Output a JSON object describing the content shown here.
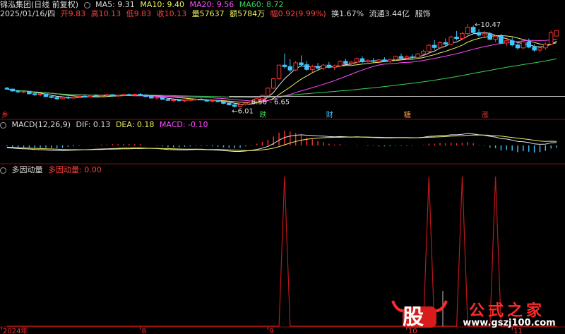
{
  "header": {
    "stock_name": "锦泓集团(日线 前复权)",
    "ma5": "MA5: 9.31",
    "ma10": "MA10: 9.40",
    "ma20": "MA20: 9.56",
    "ma60": "MA60: 8.72",
    "quote": {
      "date": "2025/01/16/四",
      "open": "开9.83",
      "high": "高10.13",
      "low": "低9.83",
      "close": "收10.13",
      "volume": "量57637",
      "amount": "额5784万",
      "change": "幅0.92(9.99%)",
      "turnover": "换1.67%",
      "float_value": "流通3.44亿",
      "sector": "服饰"
    }
  },
  "macd_panel": {
    "title": "MACD(12,26,9)",
    "dif": "DIF: 0.13",
    "dea": "DEA: 0.18",
    "macd": "MACD: -0.10"
  },
  "factor_panel": {
    "title": "多因动量",
    "value_label": "多因动量: 0.00"
  },
  "watermark": {
    "logo_char": "股",
    "brand": "公式之家",
    "url": "www.gszj100.com"
  },
  "colors": {
    "up": "#ff3030",
    "down": "#3ec6ff",
    "ma5": "#e8e8e8",
    "ma10": "#f0f060",
    "ma20": "#ff4cff",
    "ma60": "#39d353",
    "panel_border": "#7a1010",
    "factor": "#c01818"
  },
  "chart_data": [
    {
      "type": "candlestick",
      "title": "锦泓集团(日线 前复权)",
      "ylim": [
        5.8,
        10.7
      ],
      "annotations": [
        {
          "text": "10.47",
          "kind": "high"
        },
        {
          "text": "6.01",
          "kind": "low"
        },
        {
          "text": "6.56 - 6.65",
          "kind": "gap"
        }
      ],
      "event_markers": [
        "跌",
        "财",
        "糖",
        "涨"
      ],
      "ma_lines": [
        "MA5",
        "MA10",
        "MA20",
        "MA60"
      ],
      "x_ticks": [
        "2024年",
        "8",
        "9",
        "10",
        "11"
      ],
      "candles": [
        [
          7.05,
          7.12,
          6.97,
          7.0
        ],
        [
          7.0,
          7.02,
          6.86,
          6.9
        ],
        [
          6.9,
          6.95,
          6.8,
          6.85
        ],
        [
          6.85,
          6.92,
          6.78,
          6.88
        ],
        [
          6.88,
          6.9,
          6.72,
          6.75
        ],
        [
          6.75,
          6.8,
          6.64,
          6.7
        ],
        [
          6.7,
          6.78,
          6.62,
          6.74
        ],
        [
          6.74,
          6.76,
          6.58,
          6.6
        ],
        [
          6.6,
          6.66,
          6.5,
          6.55
        ],
        [
          6.55,
          6.6,
          6.44,
          6.48
        ],
        [
          6.48,
          6.58,
          6.45,
          6.56
        ],
        [
          6.56,
          6.62,
          6.48,
          6.52
        ],
        [
          6.52,
          6.6,
          6.46,
          6.58
        ],
        [
          6.58,
          6.66,
          6.54,
          6.62
        ],
        [
          6.62,
          6.68,
          6.55,
          6.6
        ],
        [
          6.6,
          6.7,
          6.56,
          6.66
        ],
        [
          6.66,
          6.72,
          6.6,
          6.64
        ],
        [
          6.64,
          6.7,
          6.58,
          6.68
        ],
        [
          6.68,
          6.74,
          6.62,
          6.7
        ],
        [
          6.7,
          6.72,
          6.6,
          6.63
        ],
        [
          6.63,
          6.7,
          6.58,
          6.67
        ],
        [
          6.67,
          6.74,
          6.62,
          6.71
        ],
        [
          6.71,
          6.76,
          6.64,
          6.68
        ],
        [
          6.68,
          6.75,
          6.63,
          6.72
        ],
        [
          6.72,
          6.78,
          6.66,
          6.69
        ],
        [
          6.69,
          6.73,
          6.58,
          6.6
        ],
        [
          6.6,
          6.64,
          6.5,
          6.52
        ],
        [
          6.52,
          6.58,
          6.44,
          6.56
        ],
        [
          6.56,
          6.6,
          6.42,
          6.45
        ],
        [
          6.45,
          6.5,
          6.36,
          6.4
        ],
        [
          6.4,
          6.46,
          6.32,
          6.42
        ],
        [
          6.42,
          6.48,
          6.34,
          6.38
        ],
        [
          6.38,
          6.44,
          6.3,
          6.41
        ],
        [
          6.41,
          6.47,
          6.35,
          6.44
        ],
        [
          6.44,
          6.5,
          6.38,
          6.46
        ],
        [
          6.46,
          6.52,
          6.4,
          6.42
        ],
        [
          6.42,
          6.46,
          6.32,
          6.36
        ],
        [
          6.36,
          6.42,
          6.28,
          6.39
        ],
        [
          6.39,
          6.44,
          6.3,
          6.33
        ],
        [
          6.33,
          6.38,
          6.2,
          6.24
        ],
        [
          6.24,
          6.3,
          6.12,
          6.16
        ],
        [
          6.16,
          6.22,
          6.01,
          6.08
        ],
        [
          6.08,
          6.2,
          6.04,
          6.18
        ],
        [
          6.18,
          6.28,
          6.12,
          6.25
        ],
        [
          6.25,
          6.4,
          6.22,
          6.36
        ],
        [
          6.36,
          6.52,
          6.32,
          6.48
        ],
        [
          6.48,
          6.7,
          6.45,
          6.66
        ],
        [
          6.66,
          7.1,
          6.64,
          7.05
        ],
        [
          7.05,
          7.6,
          7.0,
          7.55
        ],
        [
          7.55,
          8.3,
          7.5,
          8.28
        ],
        [
          8.28,
          8.9,
          8.1,
          8.2
        ],
        [
          8.2,
          8.6,
          7.9,
          8.02
        ],
        [
          8.02,
          8.5,
          7.95,
          8.4
        ],
        [
          8.4,
          8.8,
          8.2,
          8.3
        ],
        [
          8.3,
          8.5,
          7.98,
          8.05
        ],
        [
          8.05,
          8.3,
          7.9,
          8.2
        ],
        [
          8.2,
          8.4,
          8.05,
          8.12
        ],
        [
          8.12,
          8.35,
          8.0,
          8.28
        ],
        [
          8.28,
          8.45,
          8.1,
          8.16
        ],
        [
          8.16,
          8.3,
          8.02,
          8.24
        ],
        [
          8.24,
          8.55,
          8.18,
          8.48
        ],
        [
          8.48,
          8.62,
          8.3,
          8.36
        ],
        [
          8.36,
          8.5,
          8.22,
          8.44
        ],
        [
          8.44,
          8.7,
          8.38,
          8.62
        ],
        [
          8.62,
          8.75,
          8.4,
          8.46
        ],
        [
          8.46,
          8.58,
          8.34,
          8.52
        ],
        [
          8.52,
          8.66,
          8.42,
          8.48
        ],
        [
          8.48,
          8.6,
          8.36,
          8.56
        ],
        [
          8.56,
          8.7,
          8.44,
          8.5
        ],
        [
          8.5,
          8.62,
          8.4,
          8.58
        ],
        [
          8.58,
          8.8,
          8.52,
          8.74
        ],
        [
          8.74,
          8.9,
          8.6,
          8.66
        ],
        [
          8.66,
          8.8,
          8.56,
          8.72
        ],
        [
          8.72,
          8.86,
          8.62,
          8.68
        ],
        [
          8.68,
          8.92,
          8.62,
          8.88
        ],
        [
          8.88,
          9.1,
          8.8,
          9.02
        ],
        [
          9.02,
          9.4,
          8.96,
          9.34
        ],
        [
          9.34,
          9.62,
          9.1,
          9.22
        ],
        [
          9.22,
          9.55,
          9.15,
          9.48
        ],
        [
          9.48,
          9.7,
          9.3,
          9.4
        ],
        [
          9.4,
          9.85,
          9.35,
          9.78
        ],
        [
          9.78,
          10.1,
          9.6,
          9.7
        ],
        [
          9.7,
          10.05,
          9.62,
          9.96
        ],
        [
          9.96,
          10.47,
          9.9,
          10.3
        ],
        [
          10.3,
          10.4,
          9.95,
          10.02
        ],
        [
          10.02,
          10.2,
          9.8,
          9.88
        ],
        [
          9.88,
          10.1,
          9.72,
          9.96
        ],
        [
          9.96,
          10.05,
          9.6,
          9.66
        ],
        [
          9.66,
          9.9,
          9.5,
          9.82
        ],
        [
          9.82,
          9.95,
          9.4,
          9.46
        ],
        [
          9.46,
          9.7,
          9.3,
          9.58
        ],
        [
          9.58,
          9.75,
          9.28,
          9.36
        ],
        [
          9.36,
          9.5,
          9.1,
          9.2
        ],
        [
          9.2,
          9.6,
          9.12,
          9.52
        ],
        [
          9.52,
          9.7,
          9.18,
          9.24
        ],
        [
          9.24,
          9.4,
          9.0,
          9.08
        ],
        [
          9.08,
          9.3,
          8.96,
          9.2
        ],
        [
          9.2,
          9.5,
          9.1,
          9.4
        ],
        [
          9.4,
          10.13,
          9.38,
          10.0
        ],
        [
          9.83,
          10.13,
          9.83,
          10.13
        ]
      ]
    },
    {
      "type": "bar",
      "title": "MACD(12,26,9)",
      "series": [
        {
          "name": "DIF",
          "values": [
            -0.1,
            -0.12,
            -0.14,
            -0.15,
            -0.16,
            -0.18,
            -0.19,
            -0.2,
            -0.22,
            -0.23,
            -0.23,
            -0.22,
            -0.21,
            -0.2,
            -0.19,
            -0.18,
            -0.17,
            -0.16,
            -0.15,
            -0.14,
            -0.13,
            -0.12,
            -0.12,
            -0.11,
            -0.11,
            -0.12,
            -0.13,
            -0.14,
            -0.16,
            -0.18,
            -0.19,
            -0.2,
            -0.2,
            -0.19,
            -0.18,
            -0.18,
            -0.19,
            -0.2,
            -0.21,
            -0.23,
            -0.25,
            -0.27,
            -0.27,
            -0.25,
            -0.22,
            -0.18,
            -0.12,
            -0.04,
            0.08,
            0.24,
            0.36,
            0.42,
            0.46,
            0.48,
            0.46,
            0.45,
            0.43,
            0.42,
            0.4,
            0.39,
            0.4,
            0.39,
            0.38,
            0.39,
            0.38,
            0.37,
            0.36,
            0.35,
            0.34,
            0.34,
            0.35,
            0.35,
            0.35,
            0.34,
            0.35,
            0.37,
            0.41,
            0.42,
            0.45,
            0.45,
            0.48,
            0.48,
            0.5,
            0.54,
            0.52,
            0.48,
            0.46,
            0.41,
            0.38,
            0.31,
            0.29,
            0.24,
            0.18,
            0.17,
            0.13,
            0.07,
            0.05,
            0.06,
            0.12,
            0.13
          ]
        },
        {
          "name": "DEA",
          "values": [
            -0.08,
            -0.09,
            -0.1,
            -0.11,
            -0.12,
            -0.13,
            -0.14,
            -0.15,
            -0.16,
            -0.17,
            -0.18,
            -0.19,
            -0.19,
            -0.19,
            -0.19,
            -0.19,
            -0.18,
            -0.18,
            -0.17,
            -0.17,
            -0.16,
            -0.15,
            -0.15,
            -0.14,
            -0.14,
            -0.13,
            -0.13,
            -0.13,
            -0.14,
            -0.14,
            -0.15,
            -0.16,
            -0.17,
            -0.17,
            -0.17,
            -0.17,
            -0.18,
            -0.18,
            -0.18,
            -0.19,
            -0.2,
            -0.21,
            -0.22,
            -0.23,
            -0.23,
            -0.22,
            -0.2,
            -0.17,
            -0.12,
            -0.05,
            0.03,
            0.11,
            0.18,
            0.24,
            0.28,
            0.31,
            0.33,
            0.35,
            0.36,
            0.37,
            0.37,
            0.38,
            0.38,
            0.38,
            0.38,
            0.38,
            0.37,
            0.37,
            0.36,
            0.36,
            0.36,
            0.36,
            0.36,
            0.35,
            0.35,
            0.36,
            0.37,
            0.38,
            0.39,
            0.4,
            0.42,
            0.43,
            0.44,
            0.46,
            0.47,
            0.47,
            0.47,
            0.46,
            0.44,
            0.42,
            0.39,
            0.36,
            0.33,
            0.3,
            0.27,
            0.23,
            0.2,
            0.18,
            0.19,
            0.18
          ]
        },
        {
          "name": "MACD",
          "values": [
            -0.04,
            -0.06,
            -0.08,
            -0.08,
            -0.08,
            -0.1,
            -0.1,
            -0.1,
            -0.12,
            -0.12,
            -0.1,
            -0.06,
            -0.04,
            -0.02,
            0.0,
            0.02,
            0.02,
            0.04,
            0.04,
            0.06,
            0.06,
            0.06,
            0.06,
            0.06,
            0.06,
            0.02,
            0.0,
            -0.02,
            -0.04,
            -0.08,
            -0.08,
            -0.08,
            -0.06,
            -0.04,
            -0.02,
            -0.02,
            -0.02,
            -0.04,
            -0.06,
            -0.08,
            -0.1,
            -0.12,
            -0.1,
            -0.04,
            0.02,
            0.08,
            0.16,
            0.26,
            0.4,
            0.58,
            0.66,
            0.62,
            0.56,
            0.48,
            0.36,
            0.28,
            0.2,
            0.14,
            0.08,
            0.04,
            0.06,
            0.02,
            0.0,
            0.02,
            0.0,
            -0.02,
            -0.02,
            -0.04,
            -0.04,
            -0.04,
            -0.02,
            -0.02,
            -0.02,
            -0.02,
            0.0,
            0.02,
            0.08,
            0.08,
            0.12,
            0.1,
            0.12,
            0.1,
            0.12,
            0.16,
            0.1,
            0.02,
            -0.02,
            -0.1,
            -0.12,
            -0.22,
            -0.2,
            -0.24,
            -0.3,
            -0.26,
            -0.28,
            -0.32,
            -0.3,
            -0.24,
            -0.14,
            -0.1
          ]
        }
      ]
    },
    {
      "type": "line",
      "title": "多因动量",
      "series": [
        {
          "name": "多因动量",
          "values": [
            0,
            0,
            0,
            0,
            0,
            0,
            0,
            0,
            0,
            0,
            0,
            0,
            0,
            0,
            0,
            0,
            0,
            0,
            0,
            0,
            0,
            0,
            0,
            0,
            0,
            0,
            0,
            0,
            0,
            0,
            0,
            0,
            0,
            0,
            0,
            0,
            0,
            0,
            0,
            0,
            0,
            0,
            0,
            0,
            0,
            0,
            0,
            0,
            0,
            0,
            1,
            0,
            0,
            0,
            0,
            0,
            0,
            0,
            0,
            0,
            0,
            0,
            0,
            0,
            0,
            0,
            0,
            0,
            0,
            0,
            0,
            0,
            0,
            0,
            0,
            0,
            1,
            0,
            0,
            0,
            0,
            0,
            1,
            0,
            0,
            0,
            0,
            0,
            1,
            0,
            0,
            0,
            0,
            0,
            0,
            0,
            0,
            0,
            0,
            0
          ]
        }
      ]
    }
  ]
}
